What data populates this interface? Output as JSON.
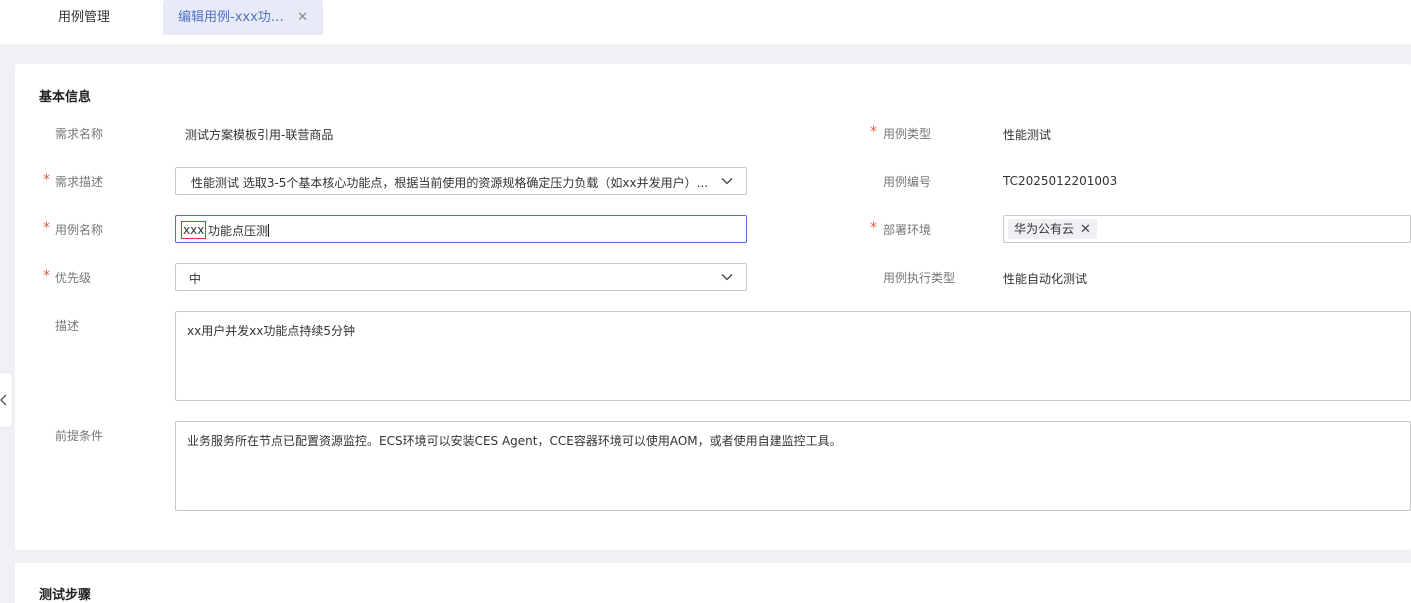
{
  "tabs": [
    {
      "label": "用例管理"
    },
    {
      "label": "编辑用例-xxx功…"
    }
  ],
  "basic_info": {
    "title": "基本信息",
    "requirement_name": {
      "label": "需求名称",
      "value": "测试方案模板引用-联营商品"
    },
    "requirement_desc": {
      "label": "需求描述",
      "value": "性能测试 选取3-5个基本核心功能点，根据当前使用的资源规格确定压力负载（如xx并发用户）..."
    },
    "case_name": {
      "label": "用例名称",
      "value_selected": "xxx",
      "value_rest": "功能点压测"
    },
    "priority": {
      "label": "优先级",
      "value": "中"
    },
    "description": {
      "label": "描述",
      "value": "xx用户并发xx功能点持续5分钟"
    },
    "precondition": {
      "label": "前提条件",
      "value": "业务服务所在节点已配置资源监控。ECS环境可以安装CES Agent，CCE容器环境可以使用AOM，或者使用自建监控工具。"
    },
    "case_type": {
      "label": "用例类型",
      "value": "性能测试"
    },
    "case_number": {
      "label": "用例编号",
      "value": "TC2025012201003"
    },
    "deploy_env": {
      "label": "部署环境",
      "tags": [
        "华为公有云"
      ]
    },
    "exec_type": {
      "label": "用例执行类型",
      "value": "性能自动化测试"
    },
    "required_mark": "*"
  },
  "test_steps": {
    "title": "测试步骤"
  },
  "colors": {
    "accent": "#5470c6",
    "required": "#e8583f",
    "highlight_border": "#d23a3a"
  }
}
